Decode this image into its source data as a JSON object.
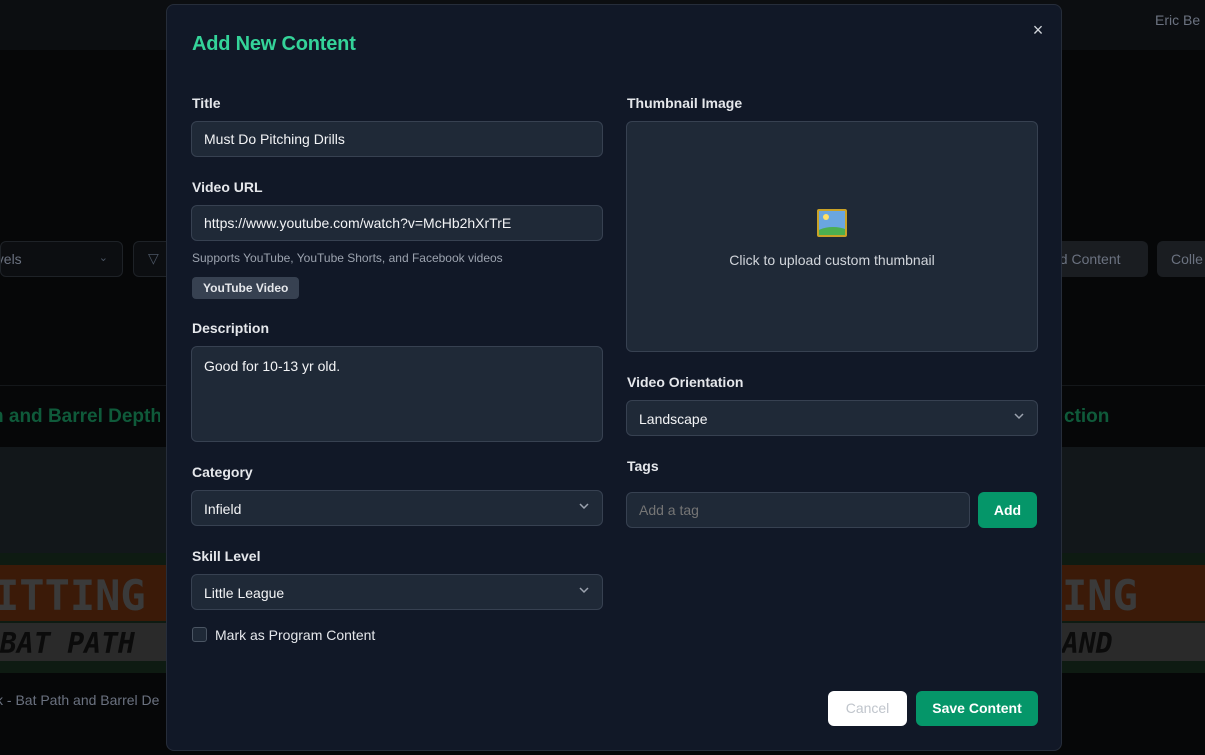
{
  "background": {
    "user_name": "Eric Be",
    "filter_select": "evels",
    "add_content": "dd Content",
    "collections": "Colle",
    "card_left_title": "h and Barrel Depth",
    "card_right_title": "ction",
    "card_left_caption": "k - Bat Path and Barrel De",
    "thumb_left_line1": "ITTING",
    "thumb_left_line2": "BAT PATH",
    "thumb_right_line1": "ING",
    "thumb_right_line2": "AND"
  },
  "modal": {
    "title": "Add New Content",
    "close_symbol": "×",
    "title_field": {
      "label": "Title",
      "value": "Must Do Pitching Drills"
    },
    "video_url": {
      "label": "Video URL",
      "value": "https://www.youtube.com/watch?v=McHb2hXrTrE",
      "hint": "Supports YouTube, YouTube Shorts, and Facebook videos",
      "badge": "YouTube Video"
    },
    "description": {
      "label": "Description",
      "value": "Good for 10-13 yr old."
    },
    "category": {
      "label": "Category",
      "value": "Infield"
    },
    "skill_level": {
      "label": "Skill Level",
      "value": "Little League"
    },
    "program_checkbox": {
      "label": "Mark as Program Content",
      "checked": false
    },
    "thumbnail": {
      "label": "Thumbnail Image",
      "upload_text": "Click to upload custom thumbnail",
      "icon": "framed-picture-icon"
    },
    "orientation": {
      "label": "Video Orientation",
      "value": "Landscape"
    },
    "tags": {
      "label": "Tags",
      "placeholder": "Add a tag",
      "add_label": "Add"
    },
    "cancel_label": "Cancel",
    "save_label": "Save Content"
  },
  "colors": {
    "accent": "#34d399",
    "primary_button": "#059669",
    "modal_bg": "#111827",
    "field_bg": "#1f2937"
  }
}
